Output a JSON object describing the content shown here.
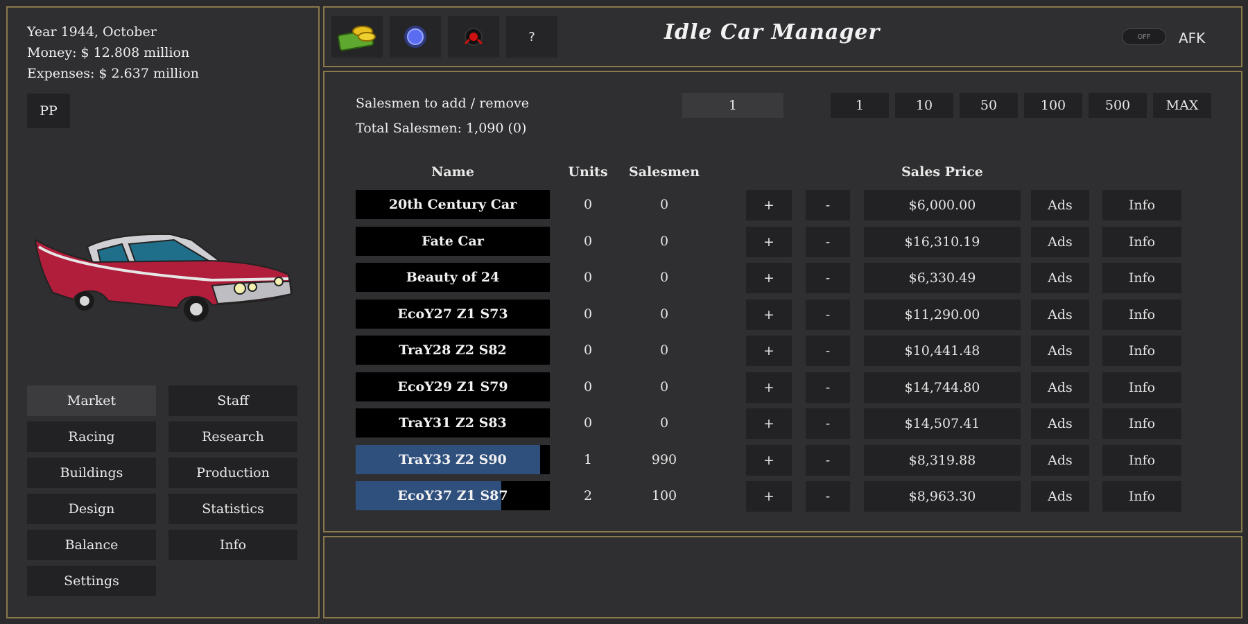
{
  "status": {
    "year": "Year 1944, October",
    "money": "Money: $ 12.808 million",
    "expenses": "Expenses: $ 2.637 million"
  },
  "pp_label": "PP",
  "nav": [
    {
      "label": "Market",
      "active": true
    },
    {
      "label": "Staff"
    },
    {
      "label": "Racing"
    },
    {
      "label": "Research"
    },
    {
      "label": "Buildings"
    },
    {
      "label": "Production"
    },
    {
      "label": "Design"
    },
    {
      "label": "Statistics"
    },
    {
      "label": "Balance"
    },
    {
      "label": "Info"
    },
    {
      "label": "Settings"
    }
  ],
  "topbar": {
    "title": "Idle Car Manager",
    "help_label": "?",
    "toggle_label": "OFF",
    "afk_label": "AFK",
    "icons": [
      "money-icon",
      "gem-icon",
      "target-icon",
      "help-icon"
    ]
  },
  "market": {
    "salesmen_label": "Salesmen to add / remove",
    "total_label": "Total Salesmen: 1,090 (0)",
    "qty_value": "1",
    "qty_buttons": [
      "1",
      "10",
      "50",
      "100",
      "500",
      "MAX"
    ],
    "headers": {
      "name": "Name",
      "units": "Units",
      "salesmen": "Salesmen",
      "price": "Sales Price"
    },
    "plus_label": "+",
    "minus_label": "-",
    "ads_label": "Ads",
    "info_label": "Info",
    "rows": [
      {
        "name": "20th Century Car",
        "units": "0",
        "salesmen": "0",
        "price": "$6,000.00",
        "fill": 0
      },
      {
        "name": "Fate Car",
        "units": "0",
        "salesmen": "0",
        "price": "$16,310.19",
        "fill": 0
      },
      {
        "name": "Beauty of 24",
        "units": "0",
        "salesmen": "0",
        "price": "$6,330.49",
        "fill": 0
      },
      {
        "name": "EcoY27 Z1 S73",
        "units": "0",
        "salesmen": "0",
        "price": "$11,290.00",
        "fill": 0
      },
      {
        "name": "TraY28 Z2 S82",
        "units": "0",
        "salesmen": "0",
        "price": "$10,441.48",
        "fill": 0
      },
      {
        "name": "EcoY29 Z1 S79",
        "units": "0",
        "salesmen": "0",
        "price": "$14,744.80",
        "fill": 0
      },
      {
        "name": "TraY31 Z2 S83",
        "units": "0",
        "salesmen": "0",
        "price": "$14,507.41",
        "fill": 0
      },
      {
        "name": "TraY33 Z2 S90",
        "units": "1",
        "salesmen": "990",
        "price": "$8,319.88",
        "fill": 0.95
      },
      {
        "name": "EcoY37 Z1 S87",
        "units": "2",
        "salesmen": "100",
        "price": "$8,963.30",
        "fill": 0.75
      }
    ]
  },
  "colors": {
    "border": "#8a7a4a",
    "progress": "#2f4f7d",
    "panel": "#2f2f31"
  }
}
